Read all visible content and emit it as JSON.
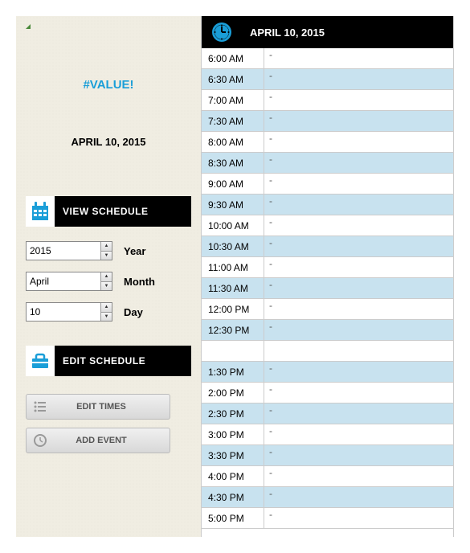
{
  "sidebar": {
    "value_error": "#VALUE!",
    "date_display": "APRIL 10, 2015",
    "view_schedule_label": "VIEW SCHEDULE",
    "edit_schedule_label": "EDIT SCHEDULE",
    "year": {
      "value": "2015",
      "label": "Year"
    },
    "month": {
      "value": "April",
      "label": "Month"
    },
    "day": {
      "value": "10",
      "label": "Day"
    },
    "edit_times_label": "EDIT TIMES",
    "add_event_label": "ADD EVENT"
  },
  "schedule": {
    "header_date": "APRIL 10, 2015",
    "rows": [
      {
        "time": "6:00 AM",
        "event": "-",
        "alt": false
      },
      {
        "time": "6:30 AM",
        "event": "-",
        "alt": true
      },
      {
        "time": "7:00 AM",
        "event": "-",
        "alt": false
      },
      {
        "time": "7:30 AM",
        "event": "-",
        "alt": true
      },
      {
        "time": "8:00 AM",
        "event": "-",
        "alt": false
      },
      {
        "time": "8:30 AM",
        "event": "-",
        "alt": true
      },
      {
        "time": "9:00 AM",
        "event": "-",
        "alt": false
      },
      {
        "time": "9:30 AM",
        "event": "-",
        "alt": true
      },
      {
        "time": "10:00 AM",
        "event": "-",
        "alt": false
      },
      {
        "time": "10:30 AM",
        "event": "-",
        "alt": true
      },
      {
        "time": "11:00 AM",
        "event": "-",
        "alt": false
      },
      {
        "time": "11:30 AM",
        "event": "-",
        "alt": true
      },
      {
        "time": "12:00 PM",
        "event": "-",
        "alt": false
      },
      {
        "time": "12:30 PM",
        "event": "-",
        "alt": true
      },
      {
        "time": "",
        "event": "",
        "alt": false,
        "blank": true
      },
      {
        "time": "1:30 PM",
        "event": "-",
        "alt": true
      },
      {
        "time": "2:00 PM",
        "event": "-",
        "alt": false
      },
      {
        "time": "2:30 PM",
        "event": "-",
        "alt": true
      },
      {
        "time": "3:00 PM",
        "event": "-",
        "alt": false
      },
      {
        "time": "3:30 PM",
        "event": "-",
        "alt": true
      },
      {
        "time": "4:00 PM",
        "event": "-",
        "alt": false
      },
      {
        "time": "4:30 PM",
        "event": "-",
        "alt": true
      },
      {
        "time": "5:00 PM",
        "event": "-",
        "alt": false
      }
    ]
  }
}
